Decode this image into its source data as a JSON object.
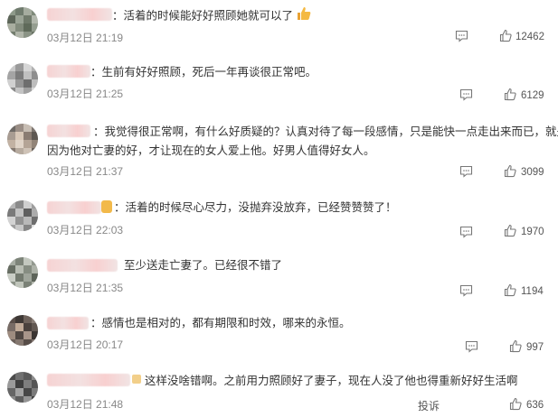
{
  "comments": [
    {
      "text": "：活着的时候能好好照顾她就可以了",
      "time": "03月12日 21:19",
      "likes": "12462",
      "has_thumb_emoji": true
    },
    {
      "text": "：生前有好好照顾，死后一年再谈很正常吧。",
      "time": "03月12日 21:25",
      "likes": "6129"
    },
    {
      "text": "：我觉得很正常啊，有什么好质疑的？认真对待了每一段感情，只是能快一点走出来而已，就是",
      "text2": "因为他对亡妻的好，才让现在的女人爱上他。好男人值得好女人。",
      "time": "03月12日 21:37",
      "likes": "3099"
    },
    {
      "text": "：活着的时候尽心尽力，没抛弃没放弃，已经赞赞赞了！",
      "time": "03月12日 22:03",
      "likes": "1970"
    },
    {
      "text": "至少送走亡妻了。已经很不错了",
      "time": "03月12日 21:35",
      "likes": "1194"
    },
    {
      "text": "：感情也是相对的，都有期限和时效，哪来的永恒。",
      "time": "03月12日 20:17",
      "likes": "997"
    },
    {
      "text": "这样没啥错啊。之前用力照顾好了妻子，现在人没了他也得重新好好生活啊",
      "time": "03月12日 21:48",
      "likes": "636",
      "report_label": "投诉"
    }
  ]
}
